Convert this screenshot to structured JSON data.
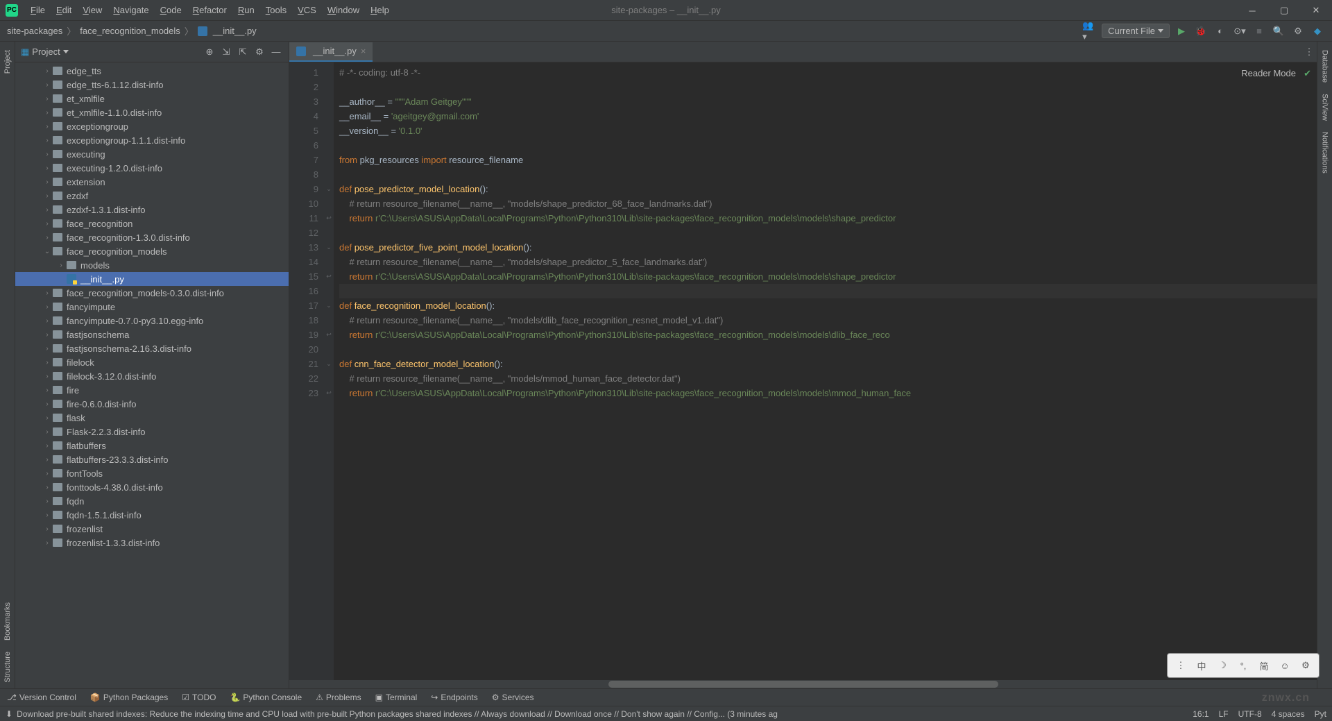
{
  "window": {
    "title": "site-packages – __init__.py",
    "menus": [
      "File",
      "Edit",
      "View",
      "Navigate",
      "Code",
      "Refactor",
      "Run",
      "Tools",
      "VCS",
      "Window",
      "Help"
    ]
  },
  "breadcrumb": [
    "site-packages",
    "face_recognition_models",
    "__init__.py"
  ],
  "run_config": "Current File",
  "project_panel": {
    "title": "Project",
    "items": [
      {
        "name": "edge_tts",
        "depth": 1,
        "arrow": "right",
        "type": "folder"
      },
      {
        "name": "edge_tts-6.1.12.dist-info",
        "depth": 1,
        "arrow": "right",
        "type": "folder"
      },
      {
        "name": "et_xmlfile",
        "depth": 1,
        "arrow": "right",
        "type": "folder"
      },
      {
        "name": "et_xmlfile-1.1.0.dist-info",
        "depth": 1,
        "arrow": "right",
        "type": "folder"
      },
      {
        "name": "exceptiongroup",
        "depth": 1,
        "arrow": "right",
        "type": "folder"
      },
      {
        "name": "exceptiongroup-1.1.1.dist-info",
        "depth": 1,
        "arrow": "right",
        "type": "folder"
      },
      {
        "name": "executing",
        "depth": 1,
        "arrow": "right",
        "type": "folder"
      },
      {
        "name": "executing-1.2.0.dist-info",
        "depth": 1,
        "arrow": "right",
        "type": "folder"
      },
      {
        "name": "extension",
        "depth": 1,
        "arrow": "right",
        "type": "folder"
      },
      {
        "name": "ezdxf",
        "depth": 1,
        "arrow": "right",
        "type": "folder"
      },
      {
        "name": "ezdxf-1.3.1.dist-info",
        "depth": 1,
        "arrow": "right",
        "type": "folder"
      },
      {
        "name": "face_recognition",
        "depth": 1,
        "arrow": "right",
        "type": "folder"
      },
      {
        "name": "face_recognition-1.3.0.dist-info",
        "depth": 1,
        "arrow": "right",
        "type": "folder"
      },
      {
        "name": "face_recognition_models",
        "depth": 1,
        "arrow": "down",
        "type": "folder"
      },
      {
        "name": "models",
        "depth": 2,
        "arrow": "right",
        "type": "folder"
      },
      {
        "name": "__init__.py",
        "depth": 2,
        "arrow": "",
        "type": "py",
        "selected": true
      },
      {
        "name": "face_recognition_models-0.3.0.dist-info",
        "depth": 1,
        "arrow": "right",
        "type": "folder"
      },
      {
        "name": "fancyimpute",
        "depth": 1,
        "arrow": "right",
        "type": "folder"
      },
      {
        "name": "fancyimpute-0.7.0-py3.10.egg-info",
        "depth": 1,
        "arrow": "right",
        "type": "folder"
      },
      {
        "name": "fastjsonschema",
        "depth": 1,
        "arrow": "right",
        "type": "folder"
      },
      {
        "name": "fastjsonschema-2.16.3.dist-info",
        "depth": 1,
        "arrow": "right",
        "type": "folder"
      },
      {
        "name": "filelock",
        "depth": 1,
        "arrow": "right",
        "type": "folder"
      },
      {
        "name": "filelock-3.12.0.dist-info",
        "depth": 1,
        "arrow": "right",
        "type": "folder"
      },
      {
        "name": "fire",
        "depth": 1,
        "arrow": "right",
        "type": "folder"
      },
      {
        "name": "fire-0.6.0.dist-info",
        "depth": 1,
        "arrow": "right",
        "type": "folder"
      },
      {
        "name": "flask",
        "depth": 1,
        "arrow": "right",
        "type": "folder"
      },
      {
        "name": "Flask-2.2.3.dist-info",
        "depth": 1,
        "arrow": "right",
        "type": "folder"
      },
      {
        "name": "flatbuffers",
        "depth": 1,
        "arrow": "right",
        "type": "folder"
      },
      {
        "name": "flatbuffers-23.3.3.dist-info",
        "depth": 1,
        "arrow": "right",
        "type": "folder"
      },
      {
        "name": "fontTools",
        "depth": 1,
        "arrow": "right",
        "type": "folder"
      },
      {
        "name": "fonttools-4.38.0.dist-info",
        "depth": 1,
        "arrow": "right",
        "type": "folder"
      },
      {
        "name": "fqdn",
        "depth": 1,
        "arrow": "right",
        "type": "folder"
      },
      {
        "name": "fqdn-1.5.1.dist-info",
        "depth": 1,
        "arrow": "right",
        "type": "folder"
      },
      {
        "name": "frozenlist",
        "depth": 1,
        "arrow": "right",
        "type": "folder"
      },
      {
        "name": "frozenlist-1.3.3.dist-info",
        "depth": 1,
        "arrow": "right",
        "type": "folder"
      }
    ]
  },
  "editor": {
    "tab_name": "__init__.py",
    "reader_mode": "Reader Mode",
    "lines": [
      {
        "n": 1,
        "html": "<span class='c-comment'># -*- coding: utf-8 -*-</span>"
      },
      {
        "n": 2,
        "html": ""
      },
      {
        "n": 3,
        "html": "<span class='c-ident'>__author__</span> = <span class='c-string'>\"\"\"Adam Geitgey\"\"\"</span>"
      },
      {
        "n": 4,
        "html": "<span class='c-ident'>__email__</span> = <span class='c-string'>'ageitgey@gmail.com'</span>"
      },
      {
        "n": 5,
        "html": "<span class='c-ident'>__version__</span> = <span class='c-string'>'0.1.0'</span>"
      },
      {
        "n": 6,
        "html": ""
      },
      {
        "n": 7,
        "html": "<span class='c-keyword'>from</span> <span class='c-ident'>pkg_resources</span> <span class='c-keyword'>import</span> <span class='c-ident'>resource_filename</span>"
      },
      {
        "n": 8,
        "html": ""
      },
      {
        "n": 9,
        "html": "<span class='c-keyword'>def</span> <span class='c-func'>pose_predictor_model_location</span>():",
        "fold": true
      },
      {
        "n": 10,
        "html": "    <span class='c-comment'># return resource_filename(__name__, \"models/shape_predictor_68_face_landmarks.dat\")</span>"
      },
      {
        "n": 11,
        "html": "    <span class='c-keyword'>return</span> <span class='c-string'>r'C:\\Users\\ASUS\\AppData\\Local\\Programs\\Python\\Python310\\Lib\\site-packages\\face_recognition_models\\models\\shape_predictor</span>",
        "ret": true
      },
      {
        "n": 12,
        "html": ""
      },
      {
        "n": 13,
        "html": "<span class='c-keyword'>def</span> <span class='c-func'>pose_predictor_five_point_model_location</span>():",
        "fold": true
      },
      {
        "n": 14,
        "html": "    <span class='c-comment'># return resource_filename(__name__, \"models/shape_predictor_5_face_landmarks.dat\")</span>"
      },
      {
        "n": 15,
        "html": "    <span class='c-keyword'>return</span> <span class='c-string'>r'C:\\Users\\ASUS\\AppData\\Local\\Programs\\Python\\Python310\\Lib\\site-packages\\face_recognition_models\\models\\shape_predictor</span>",
        "ret": true
      },
      {
        "n": 16,
        "html": "",
        "caret": true
      },
      {
        "n": 17,
        "html": "<span class='c-keyword'>def</span> <span class='c-func'>face_recognition_model_location</span>():",
        "fold": true
      },
      {
        "n": 18,
        "html": "    <span class='c-comment'># return resource_filename(__name__, \"models/dlib_face_recognition_resnet_model_v1.dat\")</span>"
      },
      {
        "n": 19,
        "html": "    <span class='c-keyword'>return</span> <span class='c-string'>r'C:\\Users\\ASUS\\AppData\\Local\\Programs\\Python\\Python310\\Lib\\site-packages\\face_recognition_models\\models\\dlib_face_reco</span>",
        "ret": true
      },
      {
        "n": 20,
        "html": ""
      },
      {
        "n": 21,
        "html": "<span class='c-keyword'>def</span> <span class='c-func'>cnn_face_detector_model_location</span>():",
        "fold": true
      },
      {
        "n": 22,
        "html": "    <span class='c-comment'># return resource_filename(__name__, \"models/mmod_human_face_detector.dat\")</span>"
      },
      {
        "n": 23,
        "html": "    <span class='c-keyword'>return</span> <span class='c-string'>r'C:\\Users\\ASUS\\AppData\\Local\\Programs\\Python\\Python310\\Lib\\site-packages\\face_recognition_models\\models\\mmod_human_face</span>",
        "ret": true
      }
    ]
  },
  "left_tool_windows": [
    "Project",
    "Bookmarks",
    "Structure"
  ],
  "right_tool_windows": [
    "Database",
    "SciView",
    "Notifications"
  ],
  "bottom_tabs": [
    "Version Control",
    "Python Packages",
    "TODO",
    "Python Console",
    "Problems",
    "Terminal",
    "Endpoints",
    "Services"
  ],
  "status": {
    "message": "Download pre-built shared indexes: Reduce the indexing time and CPU load with pre-built Python packages shared indexes // Always download // Download once // Don't show again // Config... (3 minutes ag",
    "cursor": "16:1",
    "line_sep": "LF",
    "encoding": "UTF-8",
    "indent": "4 spaces",
    "interpreter": "Pyt"
  },
  "watermark": "znwx.cn"
}
